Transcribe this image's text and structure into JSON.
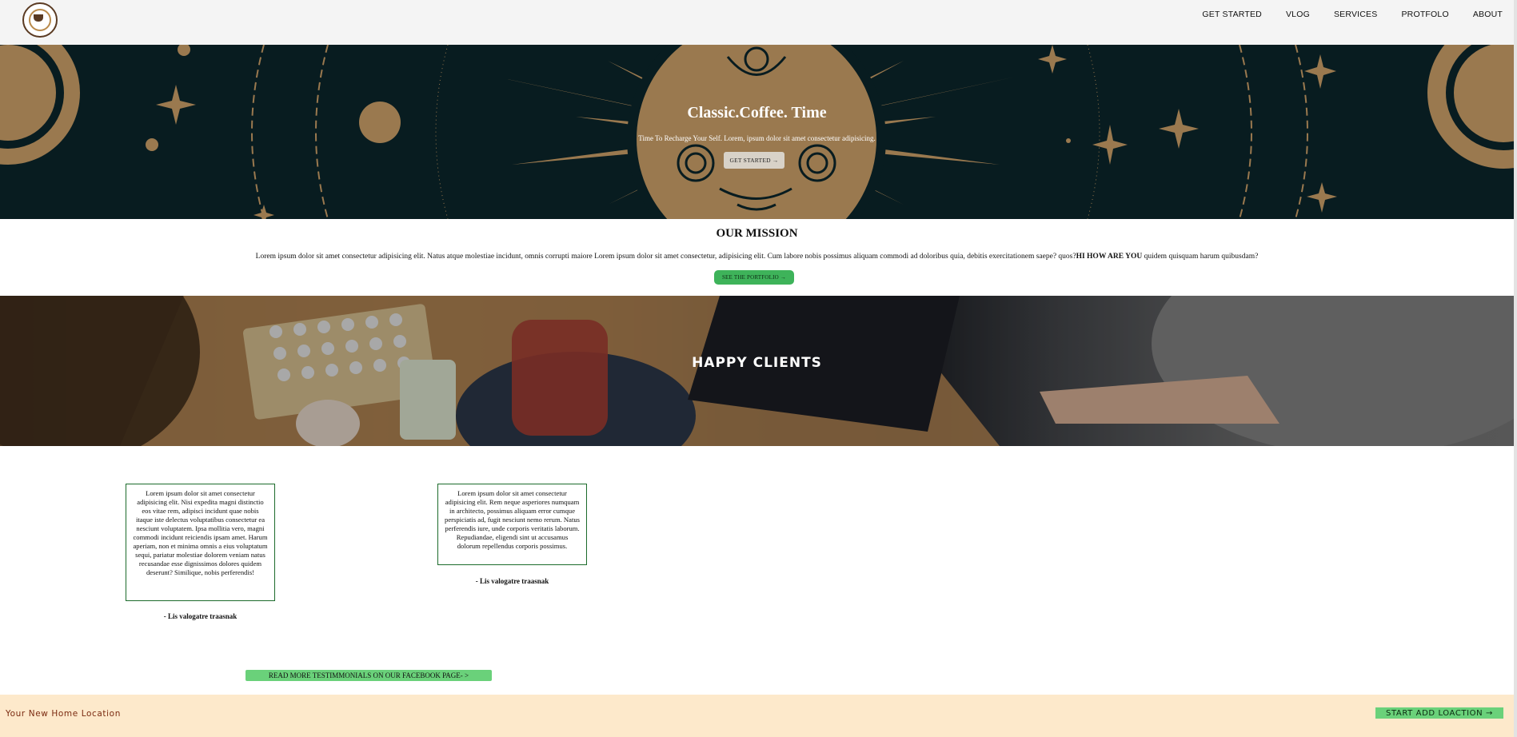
{
  "nav": {
    "links": [
      "GET STARTED",
      "VLOG",
      "SERVICES",
      "PROTFOLO",
      "ABOUT"
    ]
  },
  "hero": {
    "title": "Classic.Coffee. Time",
    "subtitle": "Time To Recharge Your Self. Lorem, ipsum dolor sit amet consectetur adipisicing.",
    "button": "GET STARTED →"
  },
  "mission": {
    "title": "OUR MISSION",
    "text_before": "Lorem ipsum dolor sit amet consectetur adipisicing elit. Natus atque molestiae incidunt, omnis corrupti maiore Lorem ipsum dolor sit amet consectetur, adipisicing elit. Cum labore nobis possimus aliquam commodi ad doloribus quia, debitis exercitationem saepe? quos?",
    "text_bold": "HI HOW ARE YOU",
    "text_after": " quidem quisquam harum quibusdam?",
    "button": "SEE THE PORTFOLIO →"
  },
  "clients": {
    "title": "HAPPY CLIENTS"
  },
  "testimonials": [
    {
      "text": "Lorem ipsum dolor sit amet consectetur adipisicing elit. Nisi expedita magni distinctio eos vitae rem, adipisci incidunt quae nobis itaque iste delectus voluptatibus consectetur ea nesciunt voluptatem. Ipsa mollitia vero, magni commodi incidunt reiciendis ipsam amet. Harum aperiam, non et minima omnis a eius voluptatum sequi, pariatur molestiae dolorem veniam natus recusandae esse dignissimos dolores quidem deserunt? Similique, nobis perferendis!",
      "author": "- Lis valogatre traasnak"
    },
    {
      "text": "Lorem ipsum dolor sit amet consectetur adipisicing elit. Rem neque asperiores numquam in architecto, possimus aliquam error cumque perspiciatis ad, fugit nesciunt nemo rerum. Natus perferendis iure, unde corporis veritatis laborum. Repudiandae, eligendi sint ut accusamus dolorum repellendus corporis possimus.",
      "author": "- Lis valogatre traasnak"
    }
  ],
  "facebook_button": "READ MORE TESTIMMONIALS ON OUR FACEBOOK PAGE- >",
  "footer": {
    "left_text": "Your New Home Location",
    "button": "START ADD LOACTION →"
  },
  "colors": {
    "hero_bg": "#0a2025",
    "hero_art": "#b08a5a",
    "mission_button": "#3eb35a",
    "accent_green": "#6ad17a",
    "footer_bg": "#fde9cb",
    "footer_text": "#7a2a10",
    "card_border": "#1c6b2b"
  }
}
